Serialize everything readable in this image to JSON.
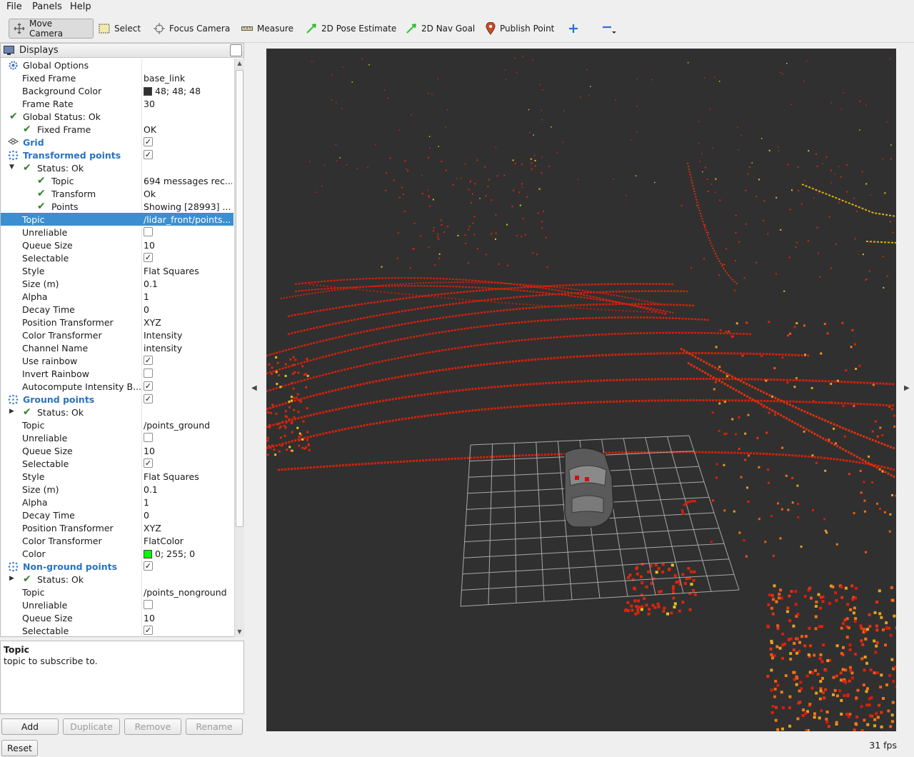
{
  "menubar": {
    "items": [
      "File",
      "Panels",
      "Help"
    ]
  },
  "toolbar": {
    "tools": [
      {
        "label": "Move Camera",
        "icon": "move-camera-icon"
      },
      {
        "label": "Select",
        "icon": "select-icon"
      },
      {
        "label": "Focus Camera",
        "icon": "focus-camera-icon"
      },
      {
        "label": "Measure",
        "icon": "measure-icon"
      },
      {
        "label": "2D Pose Estimate",
        "icon": "pose-arrow-icon"
      },
      {
        "label": "2D Nav Goal",
        "icon": "nav-goal-arrow-icon"
      },
      {
        "label": "Publish Point",
        "icon": "map-pin-icon"
      }
    ],
    "extra_icons": [
      "plus-icon",
      "minus-icon"
    ]
  },
  "displays_panel": {
    "title": "Displays",
    "rows": [
      {
        "name": "Global Options",
        "value": ""
      },
      {
        "name": "Fixed Frame",
        "value": "base_link"
      },
      {
        "name": "Background Color",
        "value": "48; 48; 48",
        "swatch": "#303030"
      },
      {
        "name": "Frame Rate",
        "value": "30"
      },
      {
        "name": "Global Status: Ok",
        "value": ""
      },
      {
        "name": "Fixed Frame",
        "value": "OK"
      },
      {
        "name": "Grid",
        "value": ""
      },
      {
        "name": "Transformed points",
        "value": ""
      },
      {
        "name": "Status: Ok",
        "value": ""
      },
      {
        "name": "Topic",
        "value": "694 messages rec..."
      },
      {
        "name": "Transform",
        "value": "Ok"
      },
      {
        "name": "Points",
        "value": "Showing [28993] ..."
      },
      {
        "name": "Topic",
        "value": "/lidar_front/points..."
      },
      {
        "name": "Unreliable",
        "value": ""
      },
      {
        "name": "Queue Size",
        "value": "10"
      },
      {
        "name": "Selectable",
        "value": ""
      },
      {
        "name": "Style",
        "value": "Flat Squares"
      },
      {
        "name": "Size (m)",
        "value": "0.1"
      },
      {
        "name": "Alpha",
        "value": "1"
      },
      {
        "name": "Decay Time",
        "value": "0"
      },
      {
        "name": "Position Transformer",
        "value": "XYZ"
      },
      {
        "name": "Color Transformer",
        "value": "Intensity"
      },
      {
        "name": "Channel Name",
        "value": "intensity"
      },
      {
        "name": "Use rainbow",
        "value": ""
      },
      {
        "name": "Invert Rainbow",
        "value": ""
      },
      {
        "name": "Autocompute Intensity B...",
        "value": ""
      },
      {
        "name": "Ground points",
        "value": ""
      },
      {
        "name": "Status: Ok",
        "value": ""
      },
      {
        "name": "Topic",
        "value": "/points_ground"
      },
      {
        "name": "Unreliable",
        "value": ""
      },
      {
        "name": "Queue Size",
        "value": "10"
      },
      {
        "name": "Selectable",
        "value": ""
      },
      {
        "name": "Style",
        "value": "Flat Squares"
      },
      {
        "name": "Size (m)",
        "value": "0.1"
      },
      {
        "name": "Alpha",
        "value": "1"
      },
      {
        "name": "Decay Time",
        "value": "0"
      },
      {
        "name": "Position Transformer",
        "value": "XYZ"
      },
      {
        "name": "Color Transformer",
        "value": "FlatColor"
      },
      {
        "name": "Color",
        "value": "0; 255; 0",
        "swatch": "#00ff00"
      },
      {
        "name": "Non-ground points",
        "value": ""
      },
      {
        "name": "Status: Ok",
        "value": ""
      },
      {
        "name": "Topic",
        "value": "/points_nonground"
      },
      {
        "name": "Unreliable",
        "value": ""
      },
      {
        "name": "Queue Size",
        "value": "10"
      },
      {
        "name": "Selectable",
        "value": ""
      }
    ]
  },
  "description": {
    "title": "Topic",
    "body": "topic to subscribe to."
  },
  "buttons": {
    "add": "Add",
    "duplicate": "Duplicate",
    "remove": "Remove",
    "rename": "Rename",
    "reset": "Reset"
  },
  "status": {
    "fps": "31 fps"
  },
  "colors": {
    "view_background": "#303030",
    "selection": "#3b8fd1",
    "display_name": "#2a72c2",
    "status_ok": "#2d7d2d"
  }
}
